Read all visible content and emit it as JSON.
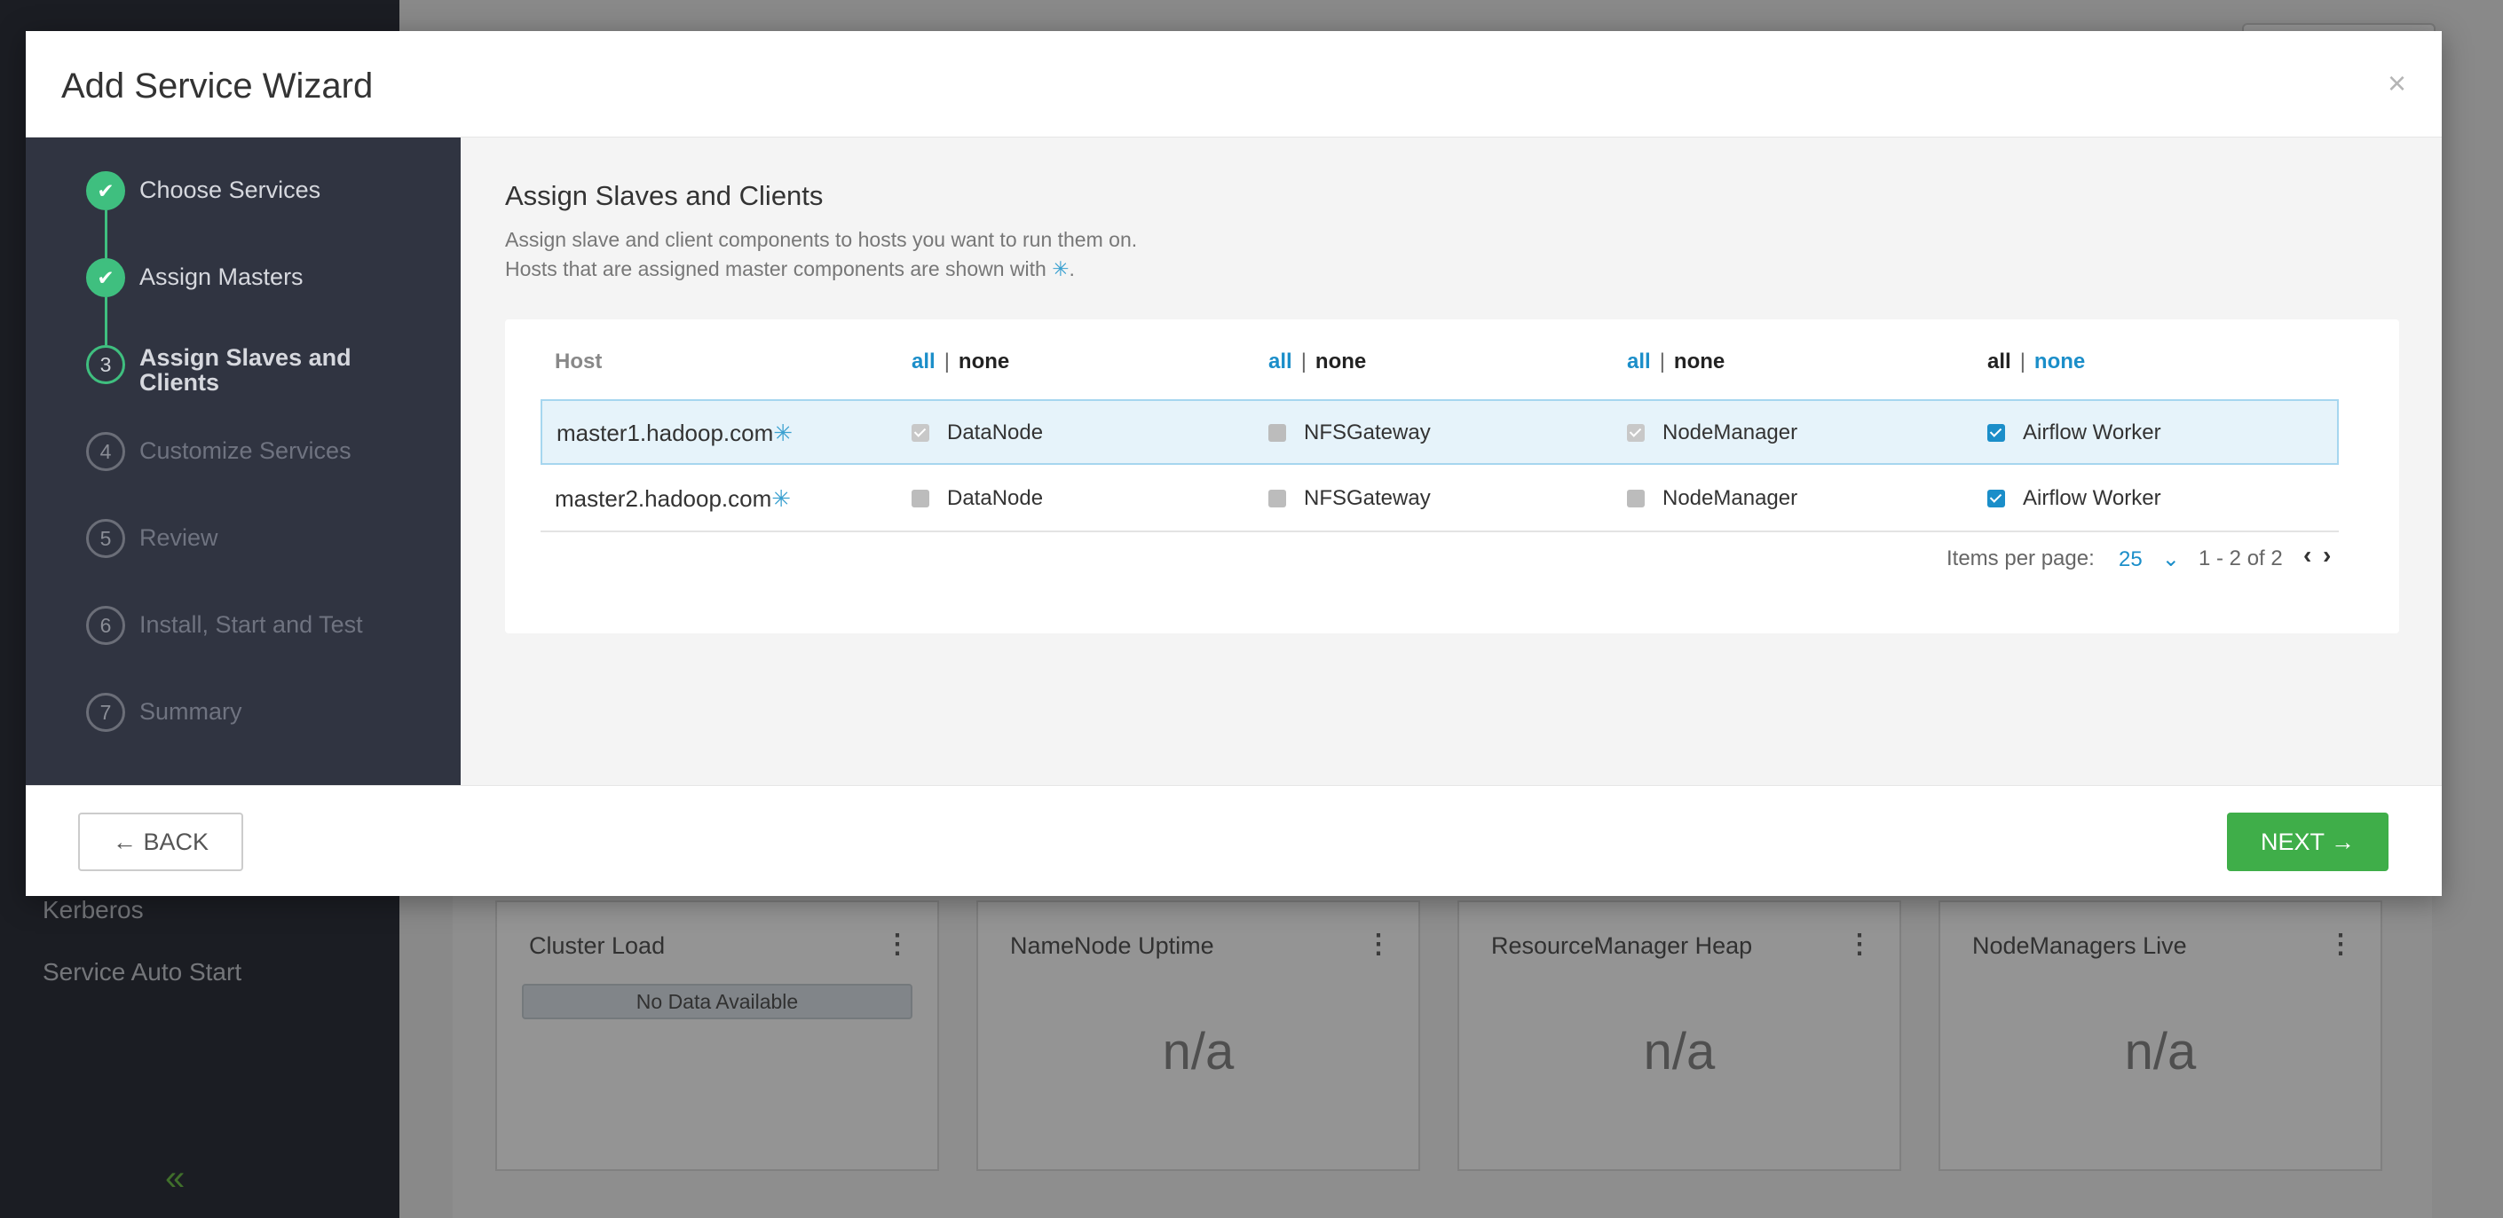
{
  "background": {
    "nav_items": [
      "Kerberos",
      "Service Auto Start"
    ],
    "collapse_glyph": "«",
    "widgets": [
      {
        "title": "Cluster Load",
        "value": "No Data Available",
        "kind": "nodata"
      },
      {
        "title": "NameNode Uptime",
        "value": "n/a",
        "kind": "value"
      },
      {
        "title": "ResourceManager Heap",
        "value": "n/a",
        "kind": "value"
      },
      {
        "title": "NodeManagers Live",
        "value": "n/a",
        "kind": "value"
      }
    ],
    "widget_menu_glyph": "⋮"
  },
  "modal": {
    "title": "Add Service Wizard",
    "close_glyph": "×"
  },
  "steps": [
    {
      "number": "1",
      "label": "Choose Services",
      "state": "done"
    },
    {
      "number": "2",
      "label": "Assign Masters",
      "state": "done"
    },
    {
      "number": "3",
      "label": "Assign Slaves and Clients",
      "state": "current"
    },
    {
      "number": "4",
      "label": "Customize Services",
      "state": "pending"
    },
    {
      "number": "5",
      "label": "Review",
      "state": "pending"
    },
    {
      "number": "6",
      "label": "Install, Start and Test",
      "state": "pending"
    },
    {
      "number": "7",
      "label": "Summary",
      "state": "pending"
    }
  ],
  "content": {
    "title": "Assign Slaves and Clients",
    "desc_line1": "Assign slave and client components to hosts you want to run them on.",
    "desc_line2_prefix": "Hosts that are assigned master components are shown with ",
    "desc_line2_star": "✳",
    "desc_line2_suffix": "."
  },
  "table": {
    "host_header": "Host",
    "all_label": "all",
    "sep": "|",
    "none_label": "none",
    "star": "✳",
    "rows": [
      {
        "host": "master1.hadoop.com",
        "components": [
          "DataNode",
          "NFSGateway",
          "NodeManager",
          "Airflow Worker"
        ]
      },
      {
        "host": "master2.hadoop.com",
        "components": [
          "DataNode",
          "NFSGateway",
          "NodeManager",
          "Airflow Worker"
        ]
      }
    ]
  },
  "pager": {
    "items_per_page_label": "Items per page:",
    "items_per_page_value": "25",
    "chevron": "⌄",
    "range": "1 - 2 of 2",
    "prev": "‹",
    "next": "›"
  },
  "footer": {
    "back_label": "← BACK",
    "next_label": "NEXT →"
  }
}
